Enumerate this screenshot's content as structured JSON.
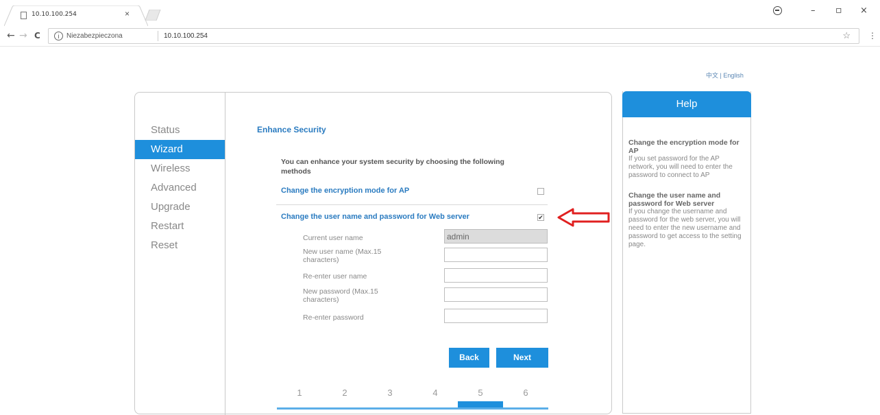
{
  "browser": {
    "tab_title": "10.10.100.254",
    "tab_close": "×",
    "secure_label": "Niezabezpieczona",
    "url": "10.10.100.254",
    "back": "←",
    "forward": "→",
    "reload": "C",
    "star": "☆",
    "menu": "⋮",
    "minimize": "–",
    "maximize": "▫",
    "close": "×"
  },
  "lang": {
    "chinese": "中文",
    "separator": "|",
    "english": "English"
  },
  "sidebar": {
    "items": [
      {
        "label": "Status",
        "active": false
      },
      {
        "label": "Wizard",
        "active": true
      },
      {
        "label": "Wireless",
        "active": false
      },
      {
        "label": "Advanced",
        "active": false
      },
      {
        "label": "Upgrade",
        "active": false
      },
      {
        "label": "Restart",
        "active": false
      },
      {
        "label": "Reset",
        "active": false
      }
    ]
  },
  "main": {
    "title": "Enhance Security",
    "intro": "You can enhance your system security by choosing the following methods",
    "option_ap": {
      "label": "Change the encryption mode for AP",
      "checked": false
    },
    "option_web": {
      "label": "Change the user name and password for Web server",
      "checked": true,
      "check_glyph": "✔"
    },
    "form": {
      "current_user_label": "Current user name",
      "current_user_value": "admin",
      "new_user_label": "New user name (Max.15 characters)",
      "reenter_user_label": "Re-enter user name",
      "new_password_label": "New password (Max.15 characters)",
      "reenter_password_label": "Re-enter password"
    },
    "back_button": "Back",
    "next_button": "Next",
    "steps": [
      "1",
      "2",
      "3",
      "4",
      "5",
      "6"
    ],
    "active_step": 5
  },
  "help": {
    "title": "Help",
    "sections": [
      {
        "heading": "Change the encryption mode for AP",
        "text": "If you set password for the AP network, you will need to enter the password to connect to AP"
      },
      {
        "heading": "Change the user name and password for Web server",
        "text": "If you change the username and password for the web server, you will need to enter the new username and password to get access to the setting page."
      }
    ]
  },
  "colors": {
    "accent": "#1e8fdc",
    "link": "#2a7bc0",
    "arrow": "#e02020"
  }
}
